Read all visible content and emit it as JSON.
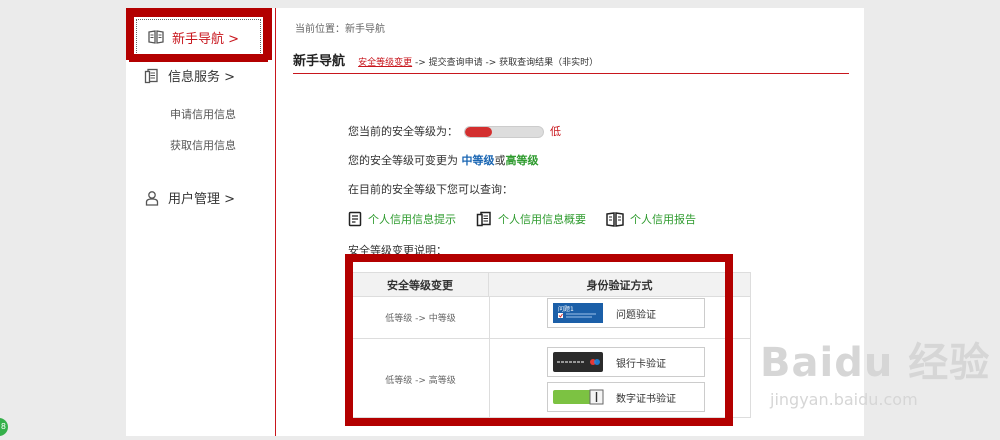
{
  "sidebar": {
    "items": [
      {
        "label": "新手导航 >",
        "icon": "book-icon",
        "active": true
      },
      {
        "label": "信息服务 >",
        "icon": "document-icon"
      },
      {
        "label": "用户管理 >",
        "icon": "user-icon"
      }
    ],
    "sub_items": [
      "申请信用信息",
      "获取信用信息"
    ]
  },
  "breadcrumb": "当前位置：新手导航",
  "page": {
    "title": "新手导航",
    "steps": {
      "current": "安全等级变更",
      "rest": " -> 提交查询申请 -> 获取查询结果（非实时）"
    }
  },
  "security": {
    "label": "您当前的安全等级为：",
    "level_text": "低",
    "level_fraction": 0.35,
    "upgrade_prefix": "您的安全等级可变更为",
    "upgrade_mid": "中等级",
    "upgrade_or": "或",
    "upgrade_high": "高等级",
    "query_intro": "在目前的安全等级下您可以查询：",
    "links": [
      "个人信用信息提示",
      "个人信用信息概要",
      "个人信用报告"
    ],
    "desc_title": "安全等级变更说明："
  },
  "table": {
    "headers": [
      "安全等级变更",
      "身份验证方式"
    ],
    "rows": [
      {
        "change": "低等级 -> 中等级",
        "methods": [
          {
            "label": "问题验证",
            "icon": "question-card-icon",
            "badge": "问题1"
          }
        ]
      },
      {
        "change": "低等级 -> 高等级",
        "methods": [
          {
            "label": "银行卡验证",
            "icon": "bank-card-icon"
          },
          {
            "label": "数字证书验证",
            "icon": "usb-key-icon"
          }
        ]
      }
    ]
  },
  "watermark": {
    "line1": "Baidu 经验",
    "line2": "jingyan.baidu.com"
  },
  "colors": {
    "accent": "#c8161d",
    "highlight_box": "#b30000",
    "link_green": "#2e9b2e",
    "mid_blue": "#1a66b3"
  }
}
